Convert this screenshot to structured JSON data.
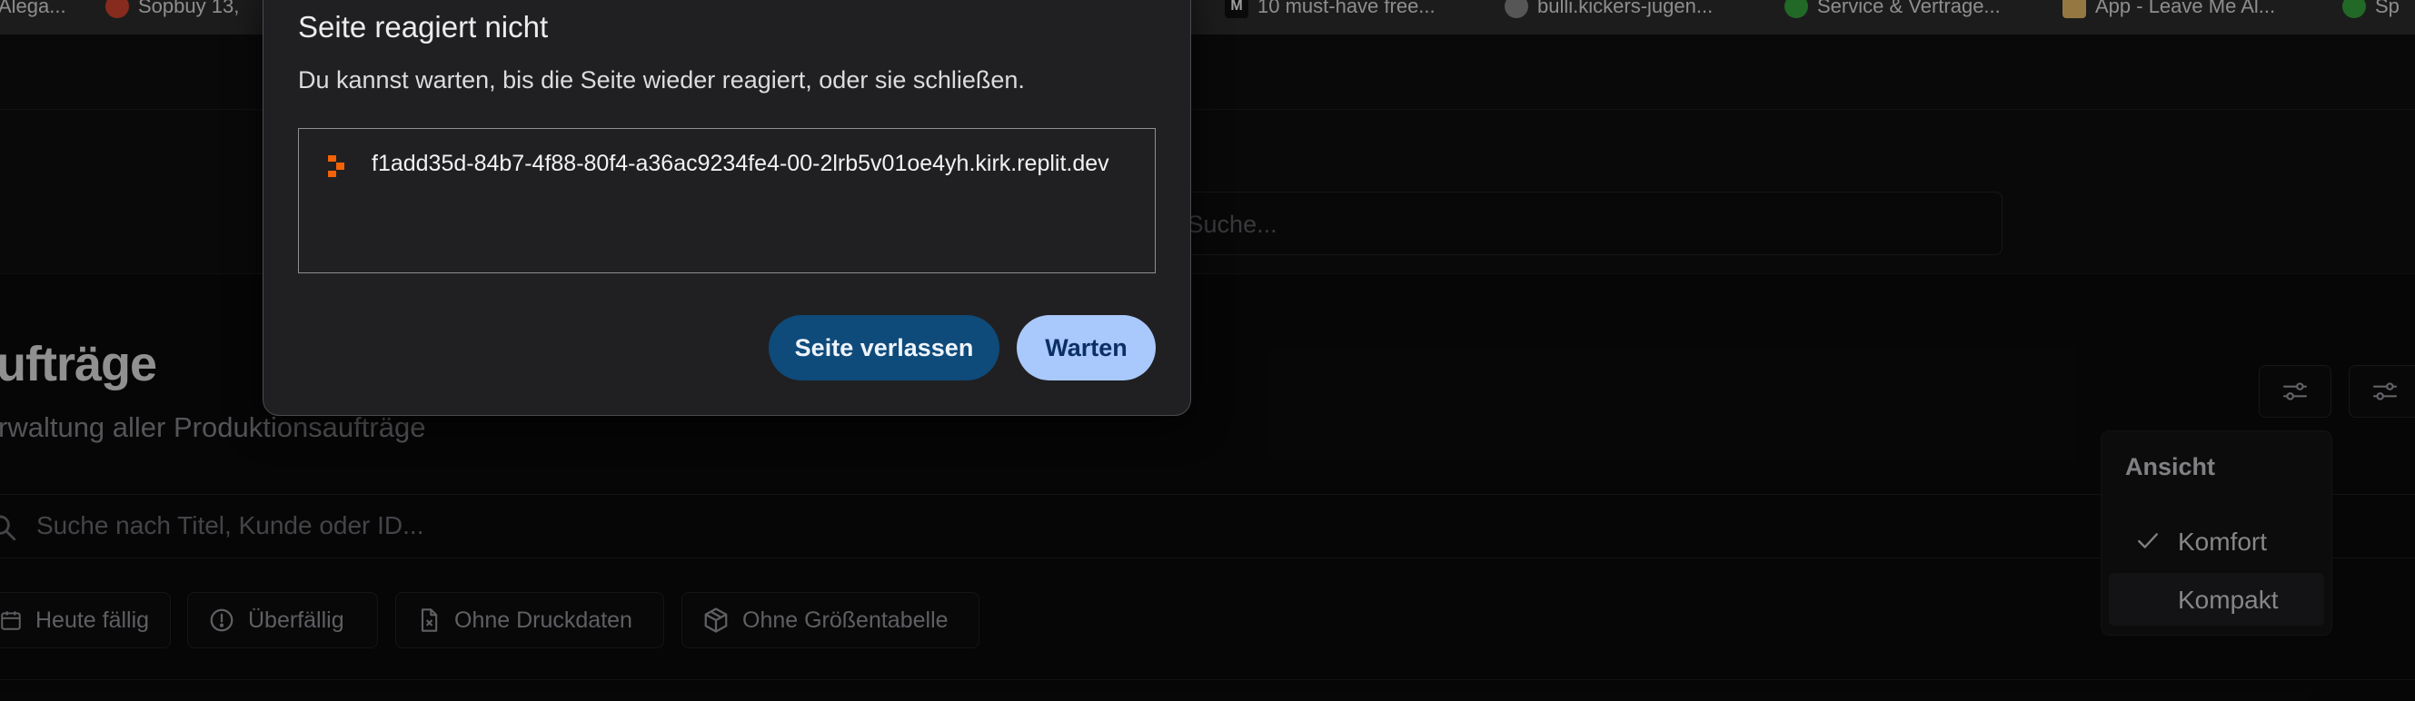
{
  "bookmarks": [
    {
      "label": "Alega...",
      "icon": "none"
    },
    {
      "label": "Sopbuy 13,",
      "icon": "sopbuy-icon"
    },
    {
      "label": "10 must-have free...",
      "icon": "mk-icon"
    },
    {
      "label": "bulli.kickers-jugen...",
      "icon": "globe-icon"
    },
    {
      "label": "Service & Vertrage...",
      "icon": "green-globe-icon"
    },
    {
      "label": "App - Leave Me Al...",
      "icon": "folder-icon"
    },
    {
      "label": "Sp",
      "icon": "green-globe-icon"
    }
  ],
  "global_search": {
    "placeholder": "ale Suche..."
  },
  "page": {
    "title": "ufträge",
    "subtitle": "rwaltung aller Produktionsaufträge"
  },
  "order_search": {
    "placeholder": "Suche nach Titel, Kunde oder ID..."
  },
  "filters": [
    {
      "label": "Heute fällig",
      "icon": "calendar-icon"
    },
    {
      "label": "Überfällig",
      "icon": "alert-circle-icon"
    },
    {
      "label": "Ohne Druckdaten",
      "icon": "file-x-icon"
    },
    {
      "label": "Ohne Größentabelle",
      "icon": "box-icon"
    }
  ],
  "view_menu": {
    "heading": "Ansicht",
    "items": [
      {
        "label": "Komfort",
        "checked": true
      },
      {
        "label": "Kompakt",
        "checked": false
      }
    ]
  },
  "dialog": {
    "title": "Seite reagiert nicht",
    "message": "Du kannst warten, bis die Seite wieder reagiert, oder sie schließen.",
    "url": "f1add35d-84b7-4f88-80f4-a36ac9234fe4-00-2lrb5v01oe4yh.kirk.replit.dev",
    "leave_label": "Seite verlassen",
    "wait_label": "Warten"
  },
  "colors": {
    "background": "#0b0b0c",
    "dialog_bg": "#202022",
    "leave_button": "#0e4a7a",
    "wait_button": "#a9c8fb",
    "replit_orange": "#f26207"
  }
}
